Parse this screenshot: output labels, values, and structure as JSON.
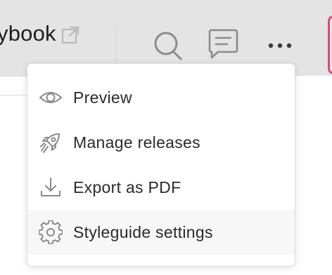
{
  "header": {
    "title": "ybook",
    "external_link_icon": "external-link-icon",
    "search_icon": "search-icon",
    "comment_icon": "comment-icon",
    "more_icon": "more-horizontal-icon",
    "accent_color": "#e0457b"
  },
  "menu": {
    "items": [
      {
        "label": "Preview",
        "icon": "eye-icon"
      },
      {
        "label": "Manage releases",
        "icon": "rocket-icon"
      },
      {
        "label": "Export as PDF",
        "icon": "download-icon"
      },
      {
        "label": "Styleguide settings",
        "icon": "gear-icon",
        "highlighted": true
      }
    ]
  }
}
